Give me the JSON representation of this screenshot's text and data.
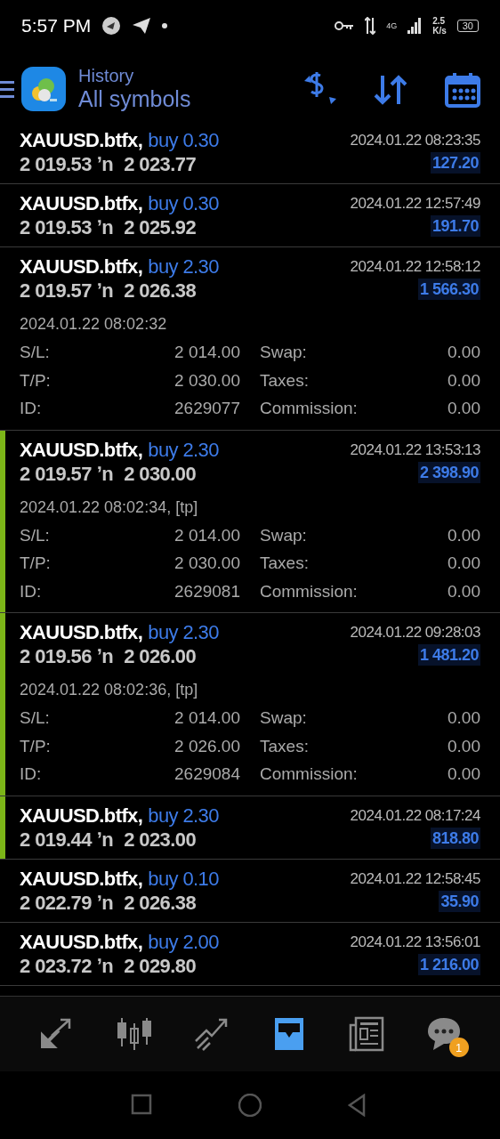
{
  "status_bar": {
    "time": "5:57 PM",
    "network_type": "4G",
    "speed": "2.5",
    "speed_unit": "K/s",
    "battery": "30"
  },
  "header": {
    "title": "History",
    "subtitle": "All symbols"
  },
  "deals": [
    {
      "symbol": "XAUUSD.btfx,",
      "order": "buy 0.30",
      "open_price": "2 019.53",
      "arrow": "ʼn",
      "close_price": "2 023.77",
      "time": "2024.01.22 08:23:35",
      "profit": "127.20",
      "highlighted": false,
      "expanded": false
    },
    {
      "symbol": "XAUUSD.btfx,",
      "order": "buy 0.30",
      "open_price": "2 019.53",
      "arrow": "ʼn",
      "close_price": "2 025.92",
      "time": "2024.01.22 12:57:49",
      "profit": "191.70",
      "highlighted": false,
      "expanded": false
    },
    {
      "symbol": "XAUUSD.btfx,",
      "order": "buy 2.30",
      "open_price": "2 019.57",
      "arrow": "ʼn",
      "close_price": "2 026.38",
      "time": "2024.01.22 12:58:12",
      "profit": "1 566.30",
      "highlighted": false,
      "expanded": true,
      "open_info": "2024.01.22 08:02:32",
      "fields": [
        {
          "label": "S/L:",
          "value": "2 014.00"
        },
        {
          "label": "Swap:",
          "value": "0.00"
        },
        {
          "label": "T/P:",
          "value": "2 030.00"
        },
        {
          "label": "Taxes:",
          "value": "0.00"
        },
        {
          "label": "ID:",
          "value": "2629077"
        },
        {
          "label": "Commission:",
          "value": "0.00"
        }
      ]
    },
    {
      "symbol": "XAUUSD.btfx,",
      "order": "buy 2.30",
      "open_price": "2 019.57",
      "arrow": "ʼn",
      "close_price": "2 030.00",
      "time": "2024.01.22 13:53:13",
      "profit": "2 398.90",
      "highlighted": true,
      "expanded": true,
      "open_info": "2024.01.22 08:02:34, [tp]",
      "fields": [
        {
          "label": "S/L:",
          "value": "2 014.00"
        },
        {
          "label": "Swap:",
          "value": "0.00"
        },
        {
          "label": "T/P:",
          "value": "2 030.00"
        },
        {
          "label": "Taxes:",
          "value": "0.00"
        },
        {
          "label": "ID:",
          "value": "2629081"
        },
        {
          "label": "Commission:",
          "value": "0.00"
        }
      ]
    },
    {
      "symbol": "XAUUSD.btfx,",
      "order": "buy 2.30",
      "open_price": "2 019.56",
      "arrow": "ʼn",
      "close_price": "2 026.00",
      "time": "2024.01.22 09:28:03",
      "profit": "1 481.20",
      "highlighted": true,
      "expanded": true,
      "open_info": "2024.01.22 08:02:36, [tp]",
      "fields": [
        {
          "label": "S/L:",
          "value": "2 014.00"
        },
        {
          "label": "Swap:",
          "value": "0.00"
        },
        {
          "label": "T/P:",
          "value": "2 026.00"
        },
        {
          "label": "Taxes:",
          "value": "0.00"
        },
        {
          "label": "ID:",
          "value": "2629084"
        },
        {
          "label": "Commission:",
          "value": "0.00"
        }
      ]
    },
    {
      "symbol": "XAUUSD.btfx,",
      "order": "buy 2.30",
      "open_price": "2 019.44",
      "arrow": "ʼn",
      "close_price": "2 023.00",
      "time": "2024.01.22 08:17:24",
      "profit": "818.80",
      "highlighted": true,
      "expanded": false
    },
    {
      "symbol": "XAUUSD.btfx,",
      "order": "buy 0.10",
      "open_price": "2 022.79",
      "arrow": "ʼn",
      "close_price": "2 026.38",
      "time": "2024.01.22 12:58:45",
      "profit": "35.90",
      "highlighted": false,
      "expanded": false
    },
    {
      "symbol": "XAUUSD.btfx,",
      "order": "buy 2.00",
      "open_price": "2 023.72",
      "arrow": "ʼn",
      "close_price": "2 029.80",
      "time": "2024.01.22 13:56:01",
      "profit": "1 216.00",
      "highlighted": false,
      "expanded": false
    }
  ],
  "nav_items": [
    {
      "kind": "trade",
      "selected": false
    },
    {
      "kind": "quotes",
      "selected": false
    },
    {
      "kind": "chart",
      "selected": false
    },
    {
      "kind": "history",
      "selected": true
    },
    {
      "kind": "news",
      "selected": false
    },
    {
      "kind": "chat",
      "selected": false,
      "badge": "1"
    }
  ]
}
